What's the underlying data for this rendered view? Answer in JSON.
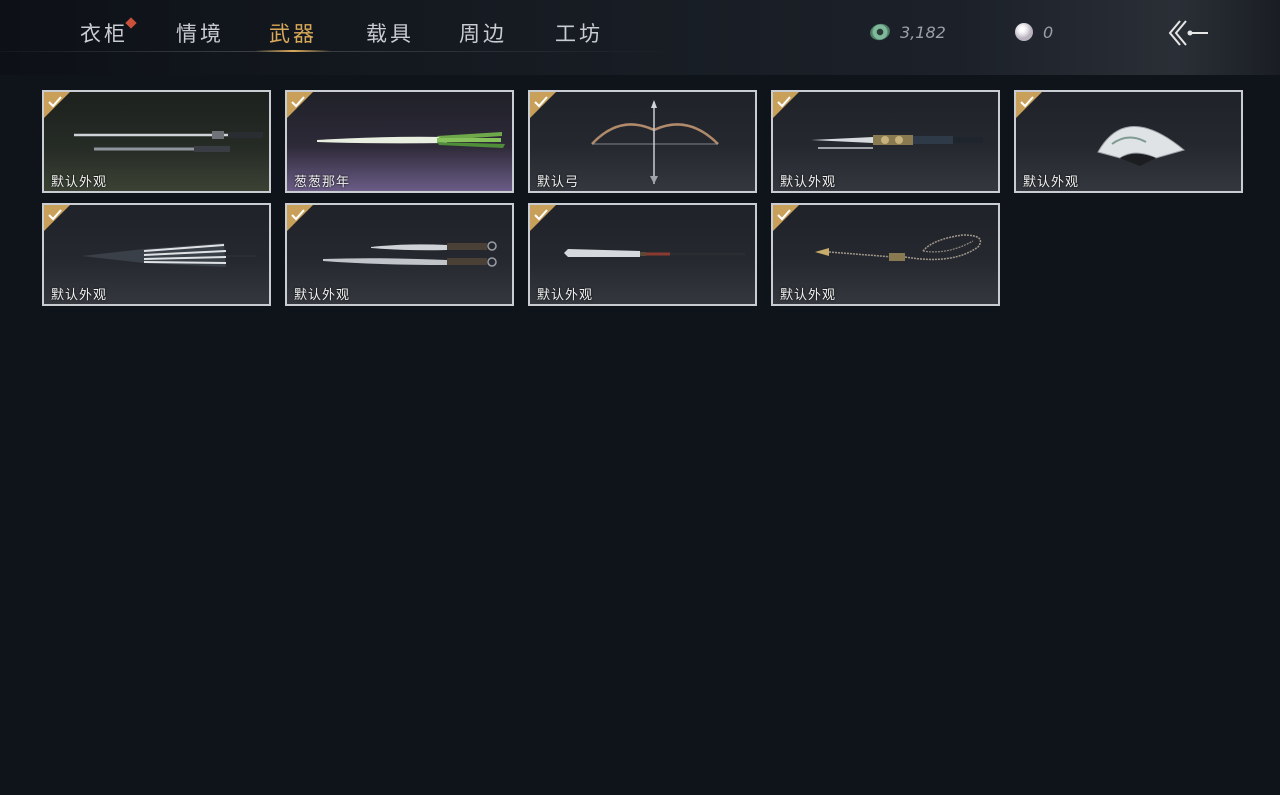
{
  "nav": {
    "tabs": [
      {
        "label": "衣柜"
      },
      {
        "label": "情境"
      },
      {
        "label": "武器"
      },
      {
        "label": "载具"
      },
      {
        "label": "周边"
      },
      {
        "label": "工坊"
      }
    ],
    "active_tab": "武器"
  },
  "currency": {
    "jade": {
      "icon": "jade-coin-icon",
      "value": "3,182"
    },
    "pearl": {
      "icon": "pearl-icon",
      "value": "0"
    }
  },
  "back_icon": "double-chevron-back-icon",
  "colors": {
    "accent": "#d9a95a",
    "badge": "#c9503a",
    "check": "#c8a05a",
    "card_border": "#c9cdd2",
    "background": "#0f131a"
  },
  "items": [
    {
      "name": "默认外观",
      "weapon": "sword",
      "equipped": true
    },
    {
      "name": "葱葱那年",
      "weapon": "scallion",
      "equipped": true
    },
    {
      "name": "默认弓",
      "weapon": "bow",
      "equipped": true
    },
    {
      "name": "默认外观",
      "weapon": "ornate-blade",
      "equipped": true
    },
    {
      "name": "默认外观",
      "weapon": "fan",
      "equipped": true
    },
    {
      "name": "默认外观",
      "weapon": "umbrella",
      "equipped": true
    },
    {
      "name": "默认外观",
      "weapon": "twin-blades",
      "equipped": true
    },
    {
      "name": "默认外观",
      "weapon": "glaive",
      "equipped": true
    },
    {
      "name": "默认外观",
      "weapon": "rope-dart",
      "equipped": true
    }
  ]
}
